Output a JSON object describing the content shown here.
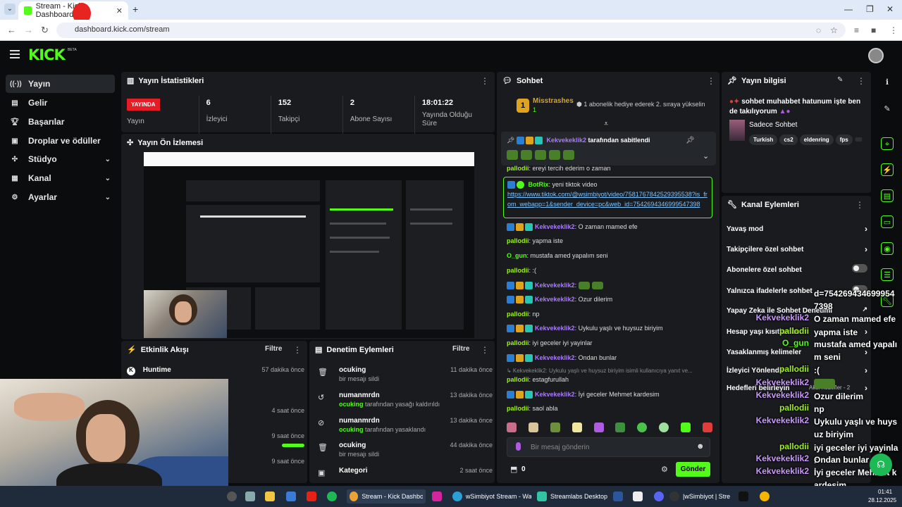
{
  "browser": {
    "tab_title": "Stream - Kick Dashboard",
    "url": "dashboard.kick.com/stream"
  },
  "header": {
    "logo": "KICK",
    "beta": "BETA"
  },
  "sidebar": {
    "items": [
      {
        "label": "Yayın",
        "icon": "broadcast-icon"
      },
      {
        "label": "Gelir",
        "icon": "revenue-icon"
      },
      {
        "label": "Başarılar",
        "icon": "trophy-icon"
      },
      {
        "label": "Droplar ve ödüller",
        "icon": "gift-icon"
      },
      {
        "label": "Stüdyo",
        "icon": "studio-icon"
      },
      {
        "label": "Kanal",
        "icon": "channel-icon"
      },
      {
        "label": "Ayarlar",
        "icon": "gear-icon"
      }
    ]
  },
  "stats": {
    "title": "Yayın İstatistikleri",
    "live_badge": "YAYINDA",
    "live_label": "Yayın",
    "viewers_value": "6",
    "viewers_label": "İzleyici",
    "followers_value": "152",
    "followers_label": "Takipçi",
    "subs_value": "2",
    "subs_label": "Abone Sayısı",
    "duration_value": "18:01:22",
    "duration_label": "Yayında Olduğu Süre"
  },
  "preview": {
    "title": "Yayın Ön İzlemesi"
  },
  "activity": {
    "title": "Etkinlik Akışı",
    "filter": "Filtre",
    "items": [
      {
        "name": "Huntime",
        "time": "57 dakika önce"
      },
      {
        "name": "",
        "time": "4 saat önce"
      },
      {
        "name": "",
        "time": "9 saat önce"
      },
      {
        "name": "",
        "time": "9 saat önce"
      }
    ]
  },
  "moderation": {
    "title": "Denetim Eylemleri",
    "filter": "Filtre",
    "items": [
      {
        "name": "ocuking",
        "actor": "",
        "desc": "bir mesajı sildi",
        "time": "11 dakika önce",
        "icon": "trash-icon"
      },
      {
        "name": "numanmrdn",
        "actor": "ocuking",
        "desc": " tarafından yasağı kaldırıldı",
        "time": "13 dakika önce",
        "icon": "undo-icon"
      },
      {
        "name": "numanmrdn",
        "actor": "ocuking",
        "desc": " tarafından yasaklandı",
        "time": "13 dakika önce",
        "icon": "ban-icon"
      },
      {
        "name": "ocuking",
        "actor": "",
        "desc": "bir mesajı sildi",
        "time": "44 dakika önce",
        "icon": "trash-icon"
      },
      {
        "name": "Kategori",
        "actor": "",
        "desc": "",
        "time": "2 saat önce",
        "icon": "category-icon"
      }
    ]
  },
  "chat": {
    "title": "Sohbet",
    "top_gifter_name": "Misstrashes",
    "top_gifter_count": "1",
    "gift_prompt": "1 abonelik hediye ederek 2. sıraya yükselin",
    "pinned_user": "Kekvekeklik2",
    "pinned_text": "tarafından sabitlendi",
    "bot_user": "BotRix",
    "bot_text": "yeni tiktok video",
    "bot_link": "https://www.tiktok.com/@wsimbiyot/video/7581767842529395538?is_from_webapp=1&sender_device=pc&web_id=7542694346999547398",
    "messages": [
      {
        "user": "pallodii",
        "text": "ereyi tercih ederim o zaman",
        "color": "u-lime",
        "badges": false
      },
      {
        "user": "Kekvekeklik2",
        "text": "O zaman mamed efe",
        "color": "u-purple",
        "badges": true
      },
      {
        "user": "pallodii",
        "text": "yapma iste",
        "color": "u-lime",
        "badges": false
      },
      {
        "user": "O_gun",
        "text": "mustafa amed yapalım seni",
        "color": "u-green",
        "badges": false
      },
      {
        "user": "pallodii",
        "text": ":(",
        "color": "u-lime",
        "badges": false
      },
      {
        "user": "Kekvekeklik2",
        "text": "",
        "color": "u-purple",
        "badges": true
      },
      {
        "user": "Kekvekeklik2",
        "text": "Ozur dilerim",
        "color": "u-purple",
        "badges": true
      },
      {
        "user": "pallodii",
        "text": "np",
        "color": "u-lime",
        "badges": false
      },
      {
        "user": "Kekvekeklik2",
        "text": "Uykulu yaşlı ve huysuz biriyim",
        "color": "u-purple",
        "badges": true
      },
      {
        "user": "pallodii",
        "text": "iyi geceler iyi yayinlar",
        "color": "u-lime",
        "badges": false
      },
      {
        "user": "Kekvekeklik2",
        "text": "Ondan bunlar",
        "color": "u-purple",
        "badges": true
      },
      {
        "user": "",
        "text": "Kekvekeklik2: Uykulu yaşlı ve huysuz biriyim isimli kullanıcıya yanıt ve...",
        "color": "",
        "badges": false
      },
      {
        "user": "pallodii",
        "text": "estagfurullah",
        "color": "u-lime",
        "badges": false
      },
      {
        "user": "Kekvekeklik2",
        "text": "İyi geceler Mehmet kardesim",
        "color": "u-purple",
        "badges": true
      },
      {
        "user": "pallodii",
        "text": "saol abla",
        "color": "u-lime",
        "badges": false
      }
    ],
    "input_placeholder": "Bir mesaj gönderin",
    "points": "0",
    "send_label": "Gönder"
  },
  "stream_info": {
    "title": "Yayın bilgisi",
    "stream_title": "sohbet muhabbet hatunum işte ben de takılıyorum",
    "category": "Sadece Sohbet",
    "tags": [
      "Turkish",
      "cs2",
      "eldenring",
      "fps"
    ]
  },
  "channel_actions": {
    "title": "Kanal Eylemleri",
    "items": [
      {
        "label": "Yavaş mod",
        "kind": "chevron"
      },
      {
        "label": "Takipçilere özel sohbet",
        "kind": "chevron"
      },
      {
        "label": "Abonelere özel sohbet",
        "kind": "toggle"
      },
      {
        "label": "Yalnızca ifadelerle sohbet",
        "kind": "toggle"
      },
      {
        "label": "Yapay Zeka ile Sohbet Denetimi",
        "kind": "link"
      },
      {
        "label": "Hesap yaşı kısıtlaması",
        "kind": "chevron"
      },
      {
        "label": "Yasaklanmış kelimeler",
        "kind": "chevron"
      },
      {
        "label": "İzleyici Yönlendir",
        "kind": "chevron"
      },
      {
        "label": "Hedefleri belirleyin",
        "kind": "chevron"
      }
    ],
    "goals_note": "Aktif hedefler - 2"
  },
  "overlay_chat": [
    {
      "user": "",
      "text": "d=7542694346999547398"
    },
    {
      "user": "Kekvekeklik2",
      "text": "O zaman mamed efe"
    },
    {
      "user": "pallodii",
      "text": "yapma iste"
    },
    {
      "user": "O_gun",
      "text": "mustafa amed yapalım seni"
    },
    {
      "user": "pallodii",
      "text": ":("
    },
    {
      "user": "Kekvekeklik2",
      "text": ""
    },
    {
      "user": "Kekvekeklik2",
      "text": "Ozur dilerim"
    },
    {
      "user": "pallodii",
      "text": "np"
    },
    {
      "user": "Kekvekeklik2",
      "text": "Uykulu yaşlı ve huysuz biriyim"
    },
    {
      "user": "pallodii",
      "text": "iyi geceler iyi yayinlar"
    },
    {
      "user": "Kekvekeklik2",
      "text": "Ondan bunlar"
    },
    {
      "user": "Kekvekeklik2",
      "text": "İyi geceler Mehmet kardesim"
    },
    {
      "user": "pallodii",
      "text": "saol abla"
    }
  ],
  "taskbar": {
    "apps": [
      {
        "label": "Stream - Kick Dashboan"
      },
      {
        "label": "wSimbiyot Stream - Wa"
      },
      {
        "label": "Streamlabs Desktop"
      },
      {
        "label": "|wSimbiyot | Stre"
      }
    ],
    "time": "01:41",
    "date": "28.12.2025"
  }
}
